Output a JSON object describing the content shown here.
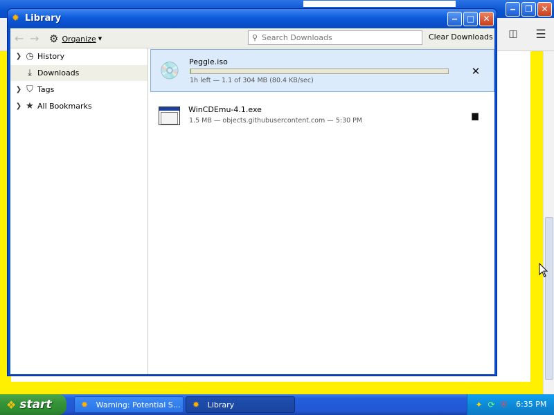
{
  "background_window": {
    "toolbar": {
      "sidebar_icon": "sidebar-icon",
      "menu_icon": "hamburger-menu-icon"
    },
    "accent_color": "#ffef00"
  },
  "library": {
    "title": "Library",
    "toolbar": {
      "organize_label": "Organize",
      "search_placeholder": "Search Downloads",
      "clear_label": "Clear Downloads"
    },
    "sidebar": {
      "items": [
        {
          "label": "History",
          "icon": "clock-icon",
          "expandable": true
        },
        {
          "label": "Downloads",
          "icon": "download-arrow-icon",
          "expandable": false,
          "selected": true
        },
        {
          "label": "Tags",
          "icon": "tag-icon",
          "expandable": true
        },
        {
          "label": "All Bookmarks",
          "icon": "star-icon",
          "expandable": true
        }
      ]
    },
    "downloads": [
      {
        "name": "Peggle.iso",
        "status": "1h left — 1.1 of 304 MB (80.4 KB/sec)",
        "progress": 0.004,
        "icon": "disc-drive-icon",
        "action_icon": "cancel-x-icon",
        "in_progress": true
      },
      {
        "name": "WinCDEmu-4.1.exe",
        "status": "1.5 MB — objects.githubusercontent.com — 5:30 PM",
        "icon": "exe-window-icon",
        "action_icon": "folder-icon",
        "in_progress": false
      }
    ]
  },
  "taskbar": {
    "start_label": "start",
    "tasks": [
      {
        "label": "Warning: Potential Se...",
        "active": false
      },
      {
        "label": "Library",
        "active": true
      }
    ],
    "clock": "6:35 PM"
  }
}
